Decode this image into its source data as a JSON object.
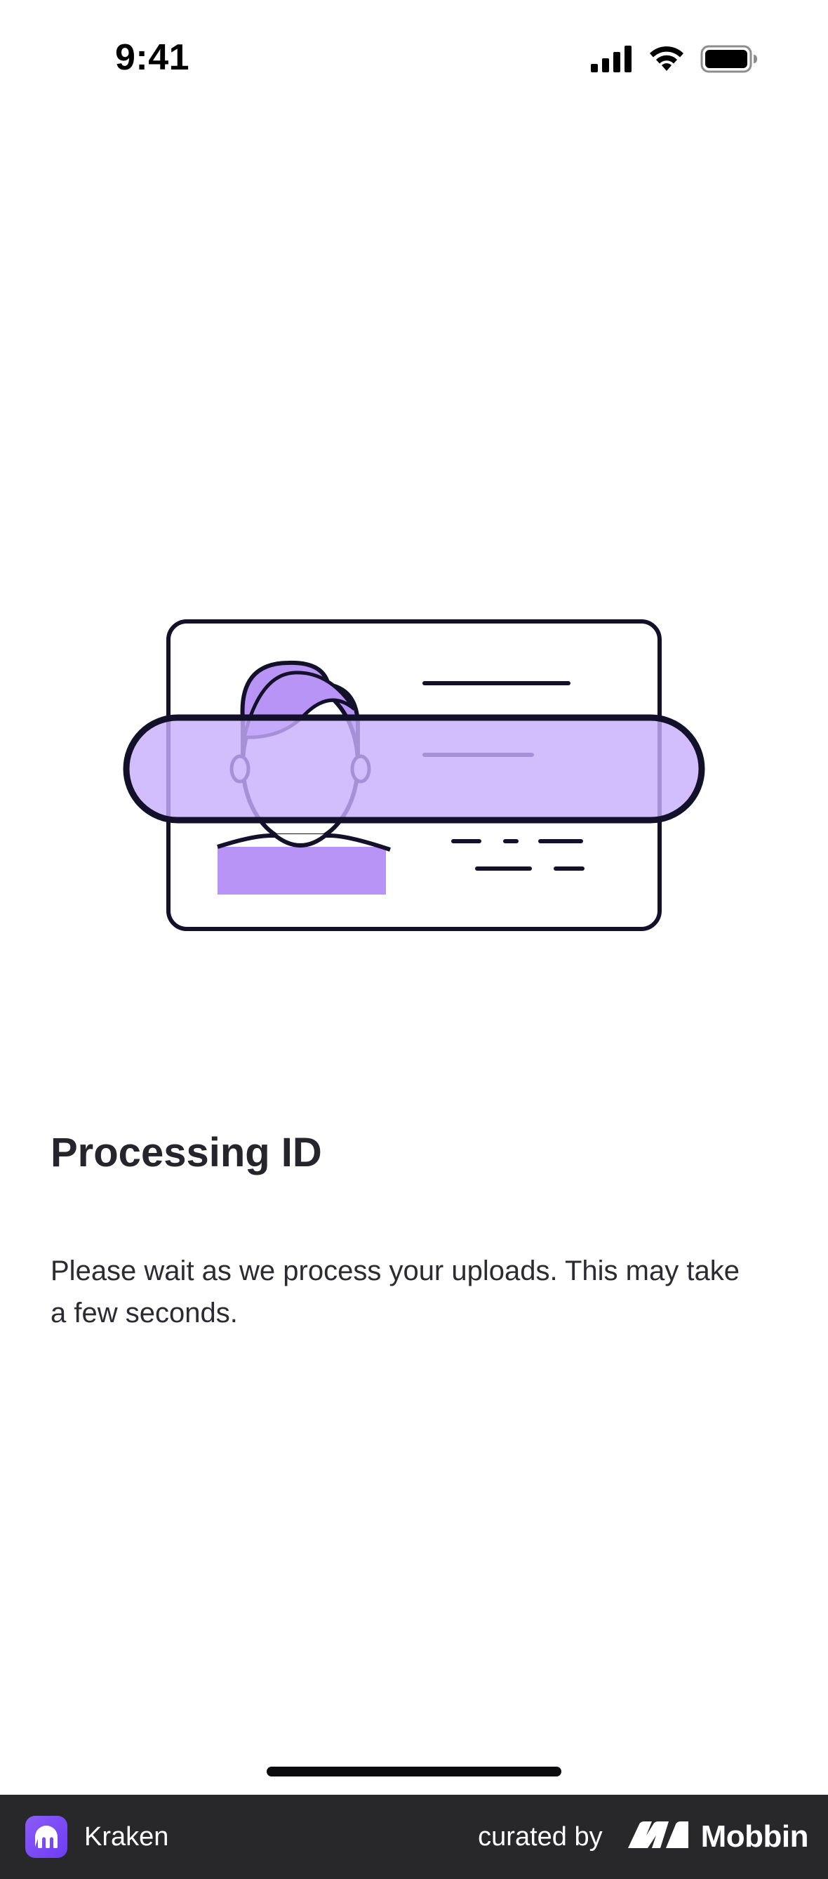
{
  "status_bar": {
    "time": "9:41",
    "icons": [
      "signal-icon",
      "wifi-icon",
      "battery-icon"
    ]
  },
  "illustration": {
    "icon": "id-card-scan-icon",
    "colors": {
      "outline": "#13102a",
      "accent": "#b794f6",
      "scan_band": "#c8aefc"
    }
  },
  "content": {
    "title": "Processing ID",
    "description": "Please wait as we process your uploads. This may take a few seconds."
  },
  "footer": {
    "app_name": "Kraken",
    "app_icon": "kraken-logo-icon",
    "curated_by": "curated by",
    "brand_name": "Mobbin",
    "brand_icon": "mobbin-logo-icon",
    "background": "#28282b",
    "accent": "#7c4dff"
  }
}
